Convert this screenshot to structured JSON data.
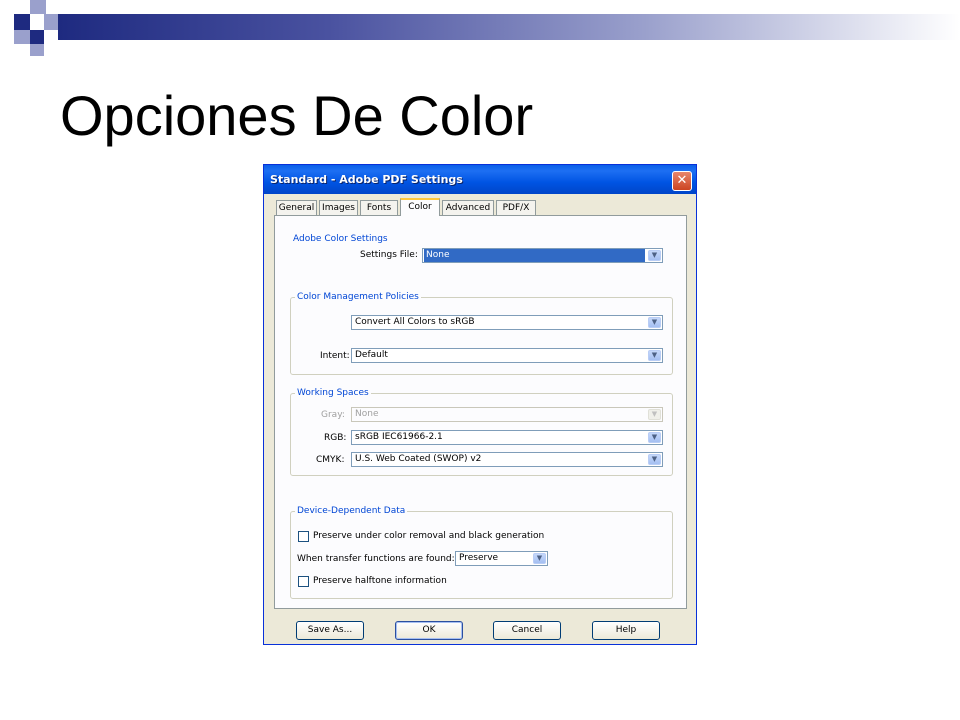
{
  "slide": {
    "title": "Opciones De Color"
  },
  "dialog": {
    "title": "Standard - Adobe PDF Settings",
    "close_glyph": "✕",
    "tabs": [
      {
        "label": "General"
      },
      {
        "label": "Images"
      },
      {
        "label": "Fonts"
      },
      {
        "label": "Color",
        "active": true
      },
      {
        "label": "Advanced"
      },
      {
        "label": "PDF/X"
      }
    ],
    "adobe_color_settings": {
      "group_label": "Adobe Color Settings",
      "settings_file_label": "Settings File:",
      "settings_file_value": "None"
    },
    "color_management": {
      "group_label": "Color Management Policies",
      "policy_value": "Convert All Colors to sRGB",
      "intent_label": "Intent:",
      "intent_value": "Default"
    },
    "working_spaces": {
      "group_label": "Working Spaces",
      "gray_label": "Gray:",
      "gray_value": "None",
      "rgb_label": "RGB:",
      "rgb_value": "sRGB IEC61966-2.1",
      "cmyk_label": "CMYK:",
      "cmyk_value": "U.S. Web Coated (SWOP) v2"
    },
    "device_dependent": {
      "group_label": "Device-Dependent Data",
      "preserve_ucr_label": "Preserve under color removal and black generation",
      "preserve_ucr_checked": false,
      "transfer_label": "When transfer functions are found:",
      "transfer_value": "Preserve",
      "preserve_halftone_label": "Preserve halftone information",
      "preserve_halftone_checked": false
    },
    "buttons": {
      "save_as": "Save As...",
      "ok": "OK",
      "cancel": "Cancel",
      "help": "Help"
    },
    "dropdown_glyph": "▼"
  },
  "colors": {
    "titlebar": "#0054e3",
    "dialog_bg": "#ece9d8",
    "group_label": "#0046d5",
    "selection": "#316ac5",
    "deco_dark": "#1e2a80",
    "deco_light": "#9aa0cc"
  }
}
